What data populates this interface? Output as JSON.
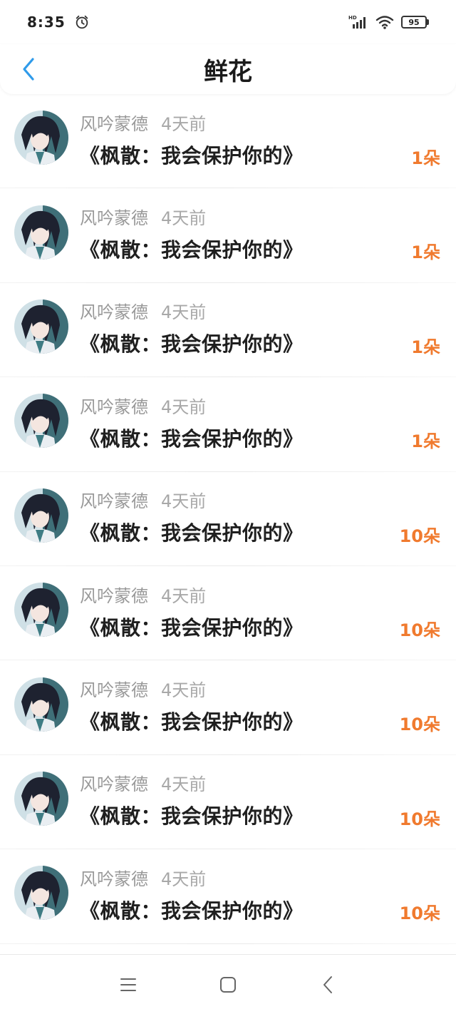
{
  "status_bar": {
    "time": "8:35",
    "battery": "95",
    "icons": [
      "alarm-icon",
      "hd-signal-icon",
      "wifi-icon",
      "battery-icon"
    ]
  },
  "header": {
    "title": "鲜花",
    "back_icon": "chevron-left-icon"
  },
  "colors": {
    "accent_back": "#2f9bea",
    "count_orange": "#f07a2e"
  },
  "items": [
    {
      "user": "风吟蒙德",
      "time": "4天前",
      "title": "《枫散：我会保护你的》",
      "count": "1朵"
    },
    {
      "user": "风吟蒙德",
      "time": "4天前",
      "title": "《枫散：我会保护你的》",
      "count": "1朵"
    },
    {
      "user": "风吟蒙德",
      "time": "4天前",
      "title": "《枫散：我会保护你的》",
      "count": "1朵"
    },
    {
      "user": "风吟蒙德",
      "time": "4天前",
      "title": "《枫散：我会保护你的》",
      "count": "1朵"
    },
    {
      "user": "风吟蒙德",
      "time": "4天前",
      "title": "《枫散：我会保护你的》",
      "count": "10朵"
    },
    {
      "user": "风吟蒙德",
      "time": "4天前",
      "title": "《枫散：我会保护你的》",
      "count": "10朵"
    },
    {
      "user": "风吟蒙德",
      "time": "4天前",
      "title": "《枫散：我会保护你的》",
      "count": "10朵"
    },
    {
      "user": "风吟蒙德",
      "time": "4天前",
      "title": "《枫散：我会保护你的》",
      "count": "10朵"
    },
    {
      "user": "风吟蒙德",
      "time": "4天前",
      "title": "《枫散：我会保护你的》",
      "count": "10朵"
    }
  ],
  "nav_bar": {
    "icons": [
      "menu-icon",
      "home-square-icon",
      "back-triangle-icon"
    ]
  }
}
